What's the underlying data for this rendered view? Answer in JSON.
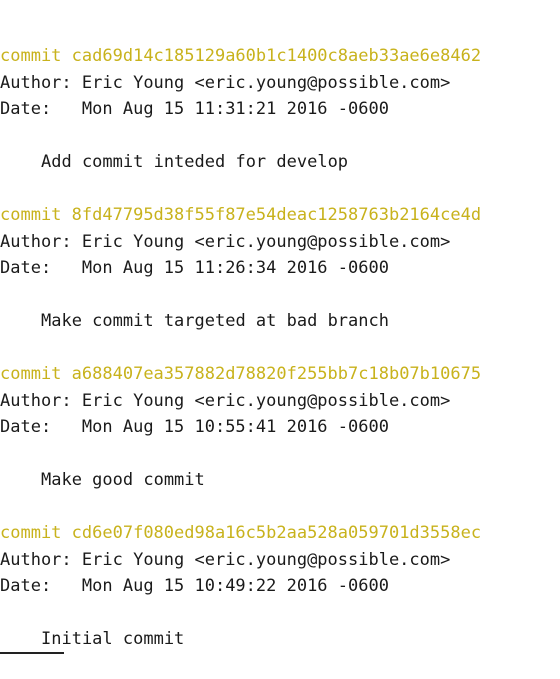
{
  "log": [
    {
      "commit_label": "commit",
      "hash": "cad69d14c185129a60b1c1400c8aeb33ae6e8462",
      "author_label": "Author:",
      "author": "Eric Young <eric.young@possible.com>",
      "date_label": "Date:",
      "date": "Mon Aug 15 11:31:21 2016 -0600",
      "message": "Add commit inteded for develop"
    },
    {
      "commit_label": "commit",
      "hash": "8fd47795d38f55f87e54deac1258763b2164ce4d",
      "author_label": "Author:",
      "author": "Eric Young <eric.young@possible.com>",
      "date_label": "Date:",
      "date": "Mon Aug 15 11:26:34 2016 -0600",
      "message": "Make commit targeted at bad branch"
    },
    {
      "commit_label": "commit",
      "hash": "a688407ea357882d78820f255bb7c18b07b10675",
      "author_label": "Author:",
      "author": "Eric Young <eric.young@possible.com>",
      "date_label": "Date:",
      "date": "Mon Aug 15 10:55:41 2016 -0600",
      "message": "Make good commit"
    },
    {
      "commit_label": "commit",
      "hash": "cd6e07f080ed98a16c5b2aa528a059701d3558ec",
      "author_label": "Author:",
      "author": "Eric Young <eric.young@possible.com>",
      "date_label": "Date:",
      "date": "Mon Aug 15 10:49:22 2016 -0600",
      "message": "Initial commit"
    }
  ],
  "colors": {
    "commit_hash": "#c8b21c",
    "text": "#1a1a1a",
    "background": "#ffffff"
  }
}
